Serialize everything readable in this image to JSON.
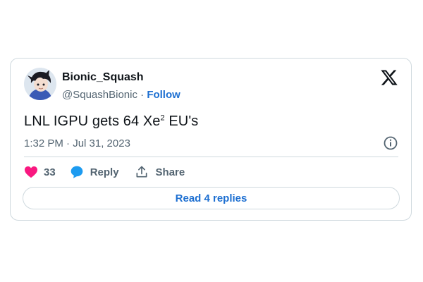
{
  "author": {
    "display_name": "Bionic_Squash",
    "handle": "@SquashBionic",
    "separator": "·",
    "follow_label": "Follow"
  },
  "tweet": {
    "text_before": "LNL IGPU gets 64 Xe",
    "text_superscript": "2",
    "text_after": " EU's",
    "timestamp": "1:32 PM · Jul 31, 2023"
  },
  "actions": {
    "like_count": "33",
    "reply_label": "Reply",
    "share_label": "Share"
  },
  "read_replies_label": "Read 4 replies",
  "icons": {
    "platform": "x-logo-icon",
    "info": "info-icon",
    "like": "heart-icon",
    "reply": "speech-bubble-icon",
    "share": "share-upload-icon"
  },
  "colors": {
    "heart": "#f91880",
    "reply_bubble": "#1d9bf0",
    "link": "#1d6fd1",
    "muted_text": "#536471",
    "border": "#cfd9de"
  }
}
